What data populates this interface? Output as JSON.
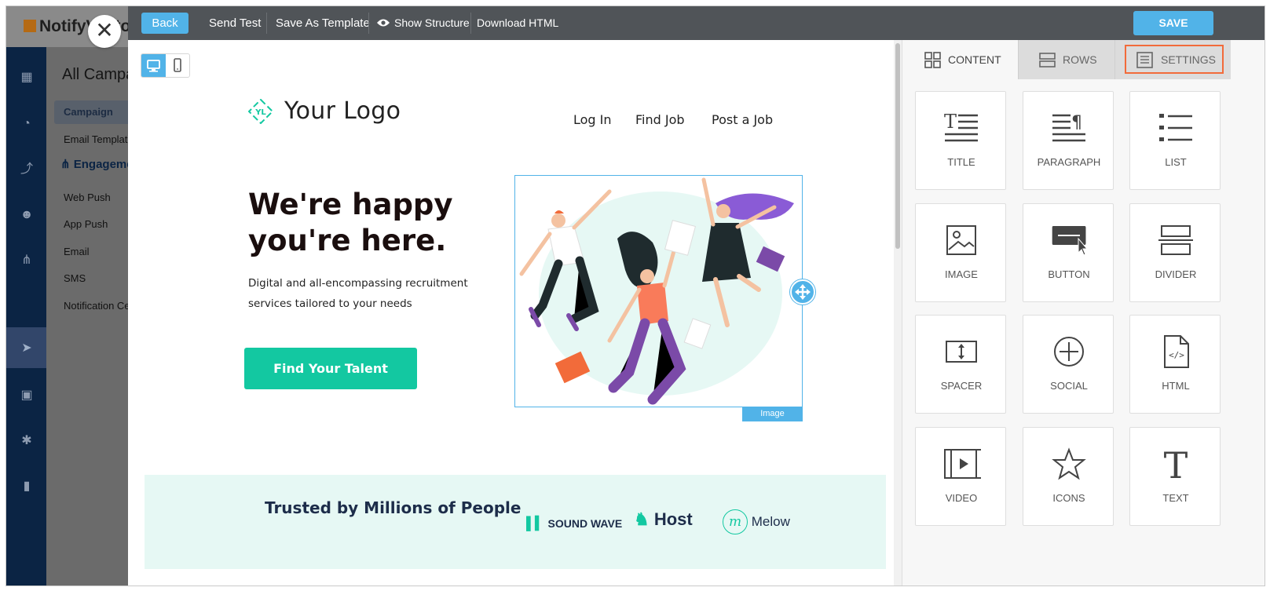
{
  "background_app": {
    "logo_text": "NotifyVisitors",
    "page_title": "All Campaigns",
    "sub_items": [
      "Campaign",
      "Email Templates"
    ],
    "section_title": "Engagement",
    "section_items": [
      "Web Push",
      "App Push",
      "Email",
      "SMS",
      "Notification Center"
    ]
  },
  "toolbar": {
    "back_label": "Back",
    "send_test_label": "Send Test",
    "save_template_label": "Save As Template",
    "show_structure_label": "Show Structure",
    "download_label": "Download HTML",
    "save_label": "SAVE"
  },
  "email": {
    "logo_mark": "YL",
    "logo_text": "Your Logo",
    "nav": [
      "Log In",
      "Find Job",
      "Post a Job"
    ],
    "hero_title_line1": "We're happy",
    "hero_title_line2": "you're here.",
    "hero_subtitle_line1": "Digital and all-encompassing recruitment",
    "hero_subtitle_line2": "services tailored to your needs",
    "cta_label": "Find Your Talent",
    "image_label": "Image",
    "trusted_title": "Trusted by Millions of People",
    "brands": [
      "SOUND WAVE",
      "Host",
      "Melow"
    ]
  },
  "panel": {
    "tabs": [
      "CONTENT",
      "ROWS",
      "SETTINGS"
    ],
    "blocks": [
      "TITLE",
      "PARAGRAPH",
      "LIST",
      "IMAGE",
      "BUTTON",
      "DIVIDER",
      "SPACER",
      "SOCIAL",
      "HTML",
      "VIDEO",
      "ICONS",
      "TEXT"
    ]
  },
  "colors": {
    "toolbar": "#505458",
    "accent": "#51b3e8",
    "cta": "#13c8a1",
    "trusted_band": "#e6f8f4",
    "settings_highlight": "#f26b3a"
  }
}
